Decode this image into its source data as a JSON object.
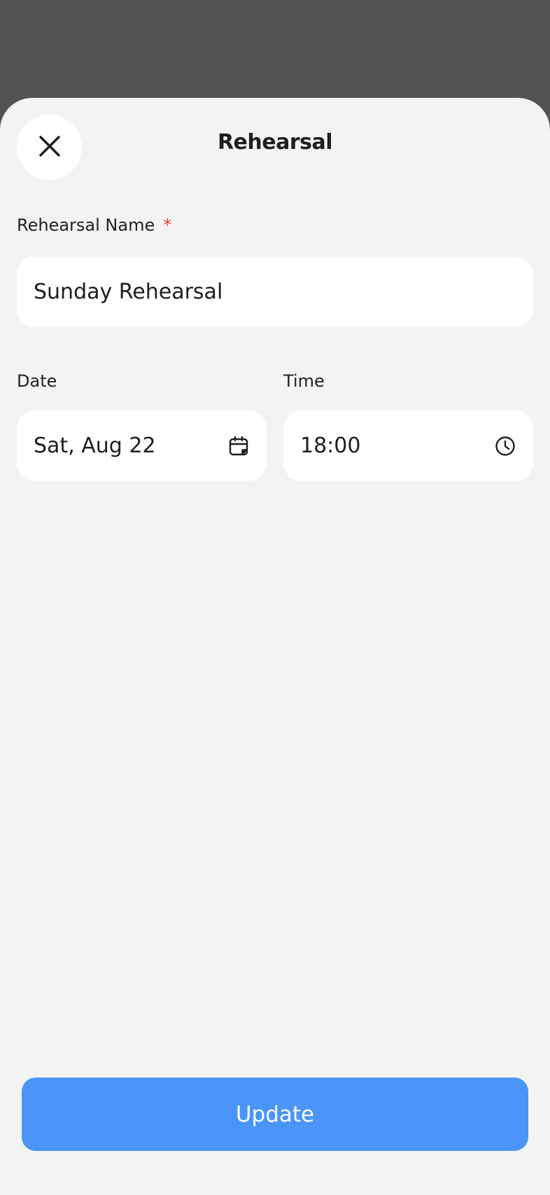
{
  "sheet": {
    "title": "Rehearsal",
    "close_icon": "close-icon"
  },
  "form": {
    "name_label": "Rehearsal Name",
    "name_required_marker": "*",
    "name_value": "Sunday Rehearsal",
    "date_label": "Date",
    "date_value": "Sat, Aug 22",
    "date_icon": "calendar-icon",
    "time_label": "Time",
    "time_value": "18:00",
    "time_icon": "clock-icon"
  },
  "actions": {
    "update_label": "Update"
  },
  "colors": {
    "backdrop": "#525252",
    "sheet_background": "#f3f3f3",
    "field_background": "#ffffff",
    "primary_button": "#4a95f7",
    "required_marker": "#e0443c"
  }
}
